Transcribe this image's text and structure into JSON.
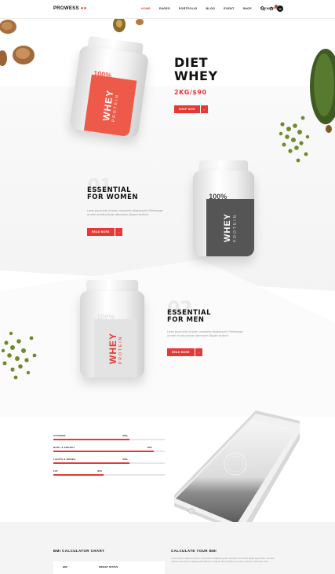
{
  "header": {
    "logo": "PROWESS",
    "logo_mark": "●●",
    "nav": [
      "HOME",
      "PAGES",
      "PORTFOLIO",
      "BLOG",
      "EVENT",
      "SHOP",
      "ELEMENTS"
    ],
    "accent": "#e53935"
  },
  "hero": {
    "title_line1": "DIET",
    "title_line2": "WHEY",
    "price": "2KG/$90",
    "button": "SHOP NOW",
    "jar_word": "WHEY",
    "jar_sub": "PROTEIN",
    "jar_number": "100%"
  },
  "women": {
    "number": "01",
    "title_line1": "ESSENTIAL",
    "title_line2": "FOR WOMEN",
    "text": "Lorem ipsum dolor sit amet, consectetur adipiscing elit. Pellentesque ac enim at nulla pulvinar ullamcorper. Aliquam tincidunt.",
    "button": "READ MORE",
    "jar_word": "WHEY",
    "jar_sub": "PROTEIN",
    "jar_number": "100%"
  },
  "men": {
    "number": "02",
    "title_line1": "ESSENTIAL",
    "title_line2": "FOR MEN",
    "text": "Lorem ipsum dolor sit amet, consectetur adipiscing elit. Pellentesque ac enim at nulla pulvinar ullamcorper. Aliquam tincidunt.",
    "button": "READ MORE",
    "jar_word": "WHEY",
    "jar_sub": "PROTEIN",
    "jar_number": "100%"
  },
  "bars": [
    {
      "label": "VITAMINS",
      "percent": "68%",
      "value": 0.68
    },
    {
      "label": "BODY & ENERGY",
      "percent": "90%",
      "value": 0.9
    },
    {
      "label": "LIGHTS & BONES",
      "percent": "68%",
      "value": 0.68
    },
    {
      "label": "FAT",
      "percent": "45%",
      "value": 0.45
    }
  ],
  "bmi": {
    "chart_title": "BMI CALCULATOR CHART",
    "calc_title": "CALCULATE YOUR BMI",
    "calc_text": "Lorem ipsum dolor sit amet, consectetur adipiscing elit. Aenean commodo ligula eget dolor. Aenean massa cum sociis natoque penatibus et magnis dis parturient montes, nascetur ridiculus mus.",
    "col_bmi": "BMI",
    "col_weight": "WEIGHT STATUS"
  }
}
